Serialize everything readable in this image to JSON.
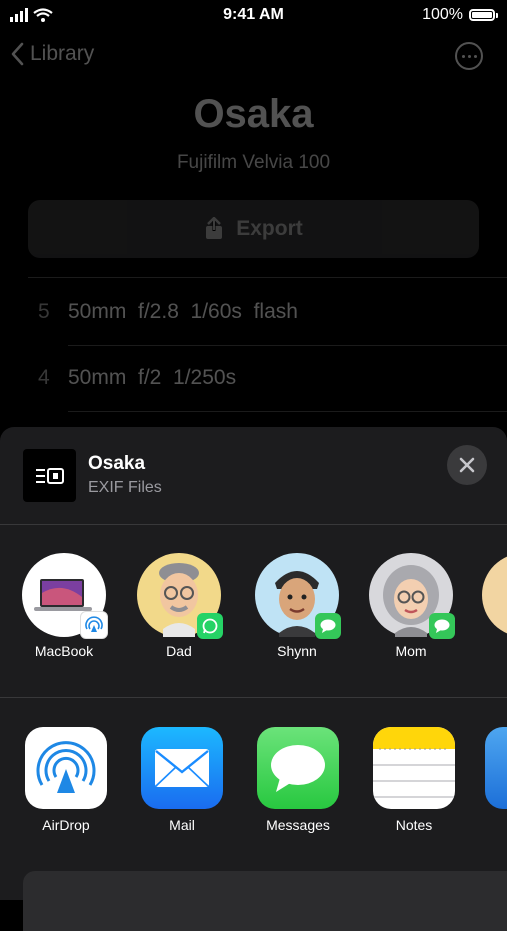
{
  "status_bar": {
    "time": "9:41 AM",
    "battery": "100%"
  },
  "nav": {
    "back_label": "Library"
  },
  "roll": {
    "title": "Osaka",
    "film": "Fujifilm Velvia 100",
    "export_label": "Export"
  },
  "shots": [
    {
      "number": "5",
      "details": "50mm  f/2.8  1/60s  flash"
    },
    {
      "number": "4",
      "details": "50mm  f/2  1/250s"
    }
  ],
  "share_sheet": {
    "title": "Osaka",
    "subtitle": "EXIF Files",
    "people": [
      {
        "name": "MacBook",
        "badge": "airdrop-badge-icon"
      },
      {
        "name": "Dad",
        "badge": "whatsapp-badge-icon"
      },
      {
        "name": "Shynn",
        "badge": "messages-badge-icon"
      },
      {
        "name": "Mom",
        "badge": "messages-badge-icon"
      }
    ],
    "apps": [
      {
        "name": "AirDrop",
        "icon": "airdrop-icon"
      },
      {
        "name": "Mail",
        "icon": "mail-icon"
      },
      {
        "name": "Messages",
        "icon": "messages-icon"
      },
      {
        "name": "Notes",
        "icon": "notes-icon"
      }
    ]
  },
  "colors": {
    "sheet_bg": "#1c1c1e",
    "whatsapp": "#25d366",
    "messages": "#34c759",
    "mail": "#1a8cff",
    "airdrop": "#1e88e5",
    "notes": "#ffd60a"
  }
}
